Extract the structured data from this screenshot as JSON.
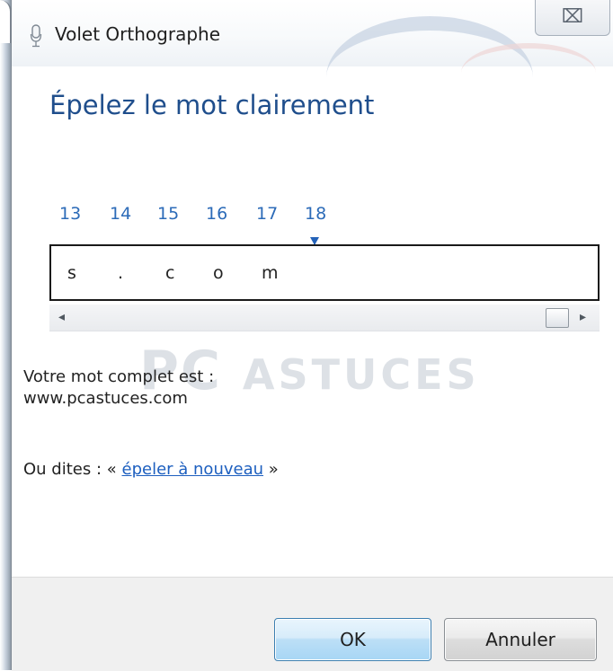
{
  "window": {
    "title": "Volet Orthographe",
    "close_glyph": "⌧"
  },
  "heading": "Épelez le mot clairement",
  "positions": [
    "13",
    "14",
    "15",
    "16",
    "17",
    "18"
  ],
  "current_position": "18",
  "spelled_chars": [
    "s",
    ".",
    "c",
    "o",
    "m"
  ],
  "complete_word": {
    "label": "Votre mot complet est :",
    "value": "www.pcastuces.com"
  },
  "say": {
    "prefix": "Ou dites : «",
    "link": "épeler à nouveau",
    "suffix": "»"
  },
  "buttons": {
    "ok": "OK",
    "cancel": "Annuler"
  },
  "watermark": {
    "brand": "PC",
    "text": "ASTUCES"
  },
  "colors": {
    "heading": "#1f4e8c",
    "position_numbers": "#2c6bb8",
    "link": "#1d5fbf"
  }
}
